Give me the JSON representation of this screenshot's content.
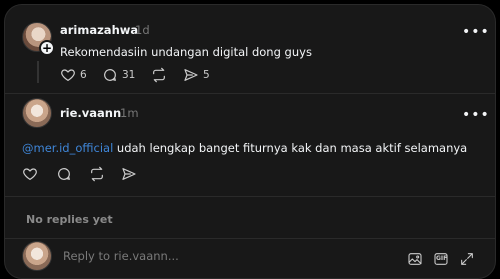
{
  "post": {
    "username": "arimazahwa",
    "time": "1d",
    "text": "Rekomendasiin undangan digital dong guys",
    "likes": "6",
    "comments": "31",
    "shares": "5"
  },
  "reply": {
    "username": "rie.vaann",
    "time": "1m",
    "mention": "@mer.id_official",
    "text": " udah lengkap banget fiturnya kak dan masa aktif selamanya"
  },
  "no_replies_label": "No replies yet",
  "composer": {
    "placeholder": "Reply to rie.vaann...",
    "gif_label": "GIF"
  },
  "more_glyph": "•••",
  "plus_glyph": "+"
}
